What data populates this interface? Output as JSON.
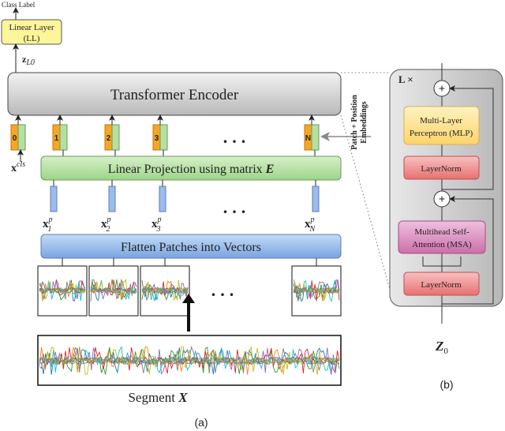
{
  "class_label": "Class Label",
  "linear_layer": {
    "line1": "Linear Layer",
    "line2": "(LL)"
  },
  "z_label": {
    "base": "z",
    "sub": "L0"
  },
  "transformer_encoder": "Transformer Encoder",
  "tokens": [
    "0",
    "1",
    "2",
    "3",
    "N"
  ],
  "ellipsis": "...",
  "embeddings_label": {
    "line1": "Patch + Position",
    "line2": "Embeddings"
  },
  "x_cls": {
    "base": "x",
    "sup": "cls"
  },
  "linear_projection": {
    "text": "Linear Projection using matrix ",
    "matrix": "E"
  },
  "patch_vectors": [
    {
      "base": "x",
      "sup": "p",
      "sub": "1"
    },
    {
      "base": "x",
      "sup": "p",
      "sub": "2"
    },
    {
      "base": "x",
      "sup": "p",
      "sub": "3"
    },
    {
      "base": "x",
      "sup": "p",
      "sub": "N"
    }
  ],
  "flatten": "Flatten Patches into Vectors",
  "segment": {
    "text": "Segment ",
    "var": "X"
  },
  "caption_a": "(a)",
  "caption_b": "(b)",
  "encoder_block": {
    "repeat": "L ×",
    "plus": "+",
    "mlp": {
      "line1": "Multi-Layer",
      "line2": "Perceptron (MLP)"
    },
    "layernorm": "LayerNorm",
    "msa": {
      "line1": "Multihead Self-",
      "line2": "Attention (MSA)"
    },
    "input": {
      "base": "Z",
      "sub": "0"
    }
  },
  "colors": {
    "token_orange": "#f5a623",
    "token_green": "#b5e0a0",
    "linear_layer": "#fdf59a",
    "projection": "#b8e2a0",
    "flatten": "#8fb6e8",
    "vector_blue": "#9dbbec",
    "mlp": "#fde69a",
    "layernorm": "#f28e8e",
    "msa": "#d888bd",
    "signals": [
      "#1f77b4",
      "#ff7f0e",
      "#2ca02c",
      "#d62728",
      "#9467bd",
      "#17becf",
      "#bcbd22",
      "#7f7f7f"
    ]
  }
}
